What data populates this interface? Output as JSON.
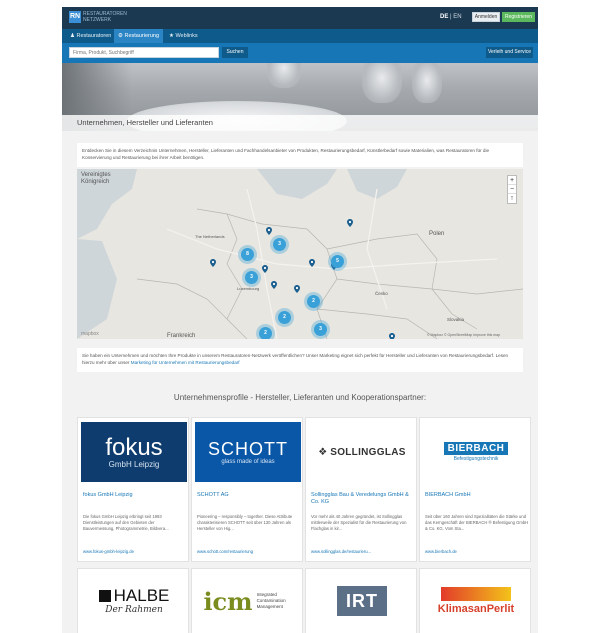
{
  "topbar": {
    "logo_line1": "RESTAURATOREN",
    "logo_line2": "NETZWERK",
    "lang_de": "DE",
    "lang_sep": " | ",
    "lang_en": "EN",
    "login_label": "Anmelden",
    "register_label": "Registrieren"
  },
  "nav": {
    "tabs": [
      {
        "label": "Restauratoren",
        "icon": "person-icon"
      },
      {
        "label": "Restaurierung",
        "icon": "gear-icon"
      },
      {
        "label": "Weblinks",
        "icon": "star-icon"
      }
    ]
  },
  "search": {
    "placeholder": "Firma, Produkt, Suchbegriff",
    "button_label": "Suchen",
    "service_label": "Verleih und Service"
  },
  "hero": {
    "title": "Unternehmen, Hersteller und Lieferanten"
  },
  "intro_text": "Entdecken Sie in diesem Verzeichnis Unternehmen, Hersteller, Lieferanten und Fachhandelsanbieter von Produkten, Restaurierungsbedarf, Künstlerbedarf sowie Materialien, was Restauratoren für die Konservierung und Restaurierung bei ihrer Arbeit benötigen.",
  "map": {
    "labels": [
      "Vereinigtes",
      "Königreich",
      "The Netherlands",
      "Polen",
      "Frankreich",
      "Luxembourg",
      "Česko",
      "Slovakia"
    ],
    "clusters": [
      "8",
      "3",
      "3",
      "5",
      "2",
      "2",
      "2",
      "3"
    ],
    "attribution": "© Mapbox © OpenStreetMap Improve this map",
    "mapbox_label": "mapbox",
    "zoom_in": "+",
    "zoom_out": "−",
    "compass": "↑"
  },
  "marketing": {
    "text": "Sie haben ein Unternehmen und möchten Ihre Produkte in unserem Restauratoren-Netzwerk veröffentlichen? Unser Marketing eignet sich perfekt für Hersteller und Lieferanten von Restaurierungsbedarf. Lesen hierzu mehr über unser",
    "link": "Marketing für Unternehmen mit Restaurierungsbedarf"
  },
  "profiles_title": "Unternehmensprofile - Hersteller, Lieferanten und Kooperationspartner:",
  "cards": [
    {
      "name": "fokus GmbH Leipzig",
      "logo_text": "fokus",
      "logo_sub": "GmbH Leipzig",
      "desc": "Die fokus GmbH Leipzig erbringt seit 1993 Dienstleistungen auf den Gebieten der Bauvermessung, Photogrammetrie, Bildvera...",
      "url": "www.fokus-gmbh-leipzig.de",
      "logo_bg": "#0f3c6e"
    },
    {
      "name": "SCHOTT AG",
      "logo_text": "SCHOTT",
      "logo_sub": "glass made of ideas",
      "desc": "Pioneering – responsibly – together. Diese Attribute charakterisieren SCHOTT seit über 130 Jahren als Hersteller von Hig...",
      "url": "www.schott.com/restaurierung",
      "logo_bg": "#0a57a7"
    },
    {
      "name": "Sollingglas Bau & Veredelungs GmbH & Co. KG",
      "logo_text": "SOLLINGGLAS",
      "logo_sub": "",
      "desc": "Vor mehr als 40 Jahren gegründet, ist Sollingglas mittlerweile der Spezialist für die Restaurierung von Flachglas in kir...",
      "url": "www.sollingglas.de/restaurieru...",
      "logo_bg": "#ffffff"
    },
    {
      "name": "BIERBACH GmbH",
      "logo_text": "BIERBACH",
      "logo_sub": "Befestigungstechnik",
      "desc": "Seit über 160 Jahren sind Spezialitäten die Stärke und das Kerngeschäft der BIERBACH ® Befestigung GmbH & Co. KG. Vom Sta...",
      "url": "www.bierbach.de",
      "logo_bg": "#ffffff"
    }
  ],
  "cards_row2": [
    {
      "logo_text": "HALBE",
      "logo_sub": "Der Rahmen"
    },
    {
      "logo_text": "icm",
      "logo_sub": "Integrated Contamination Management"
    },
    {
      "logo_text": "IRT",
      "logo_sub": ""
    },
    {
      "logo_text": "KlimasanPerlit",
      "logo_sub": ""
    }
  ],
  "colors": {
    "topbar": "#1b3a52",
    "nav": "#0e5a8a",
    "search": "#1777b6",
    "accent": "#3aa0d8",
    "register": "#5cb85c"
  }
}
